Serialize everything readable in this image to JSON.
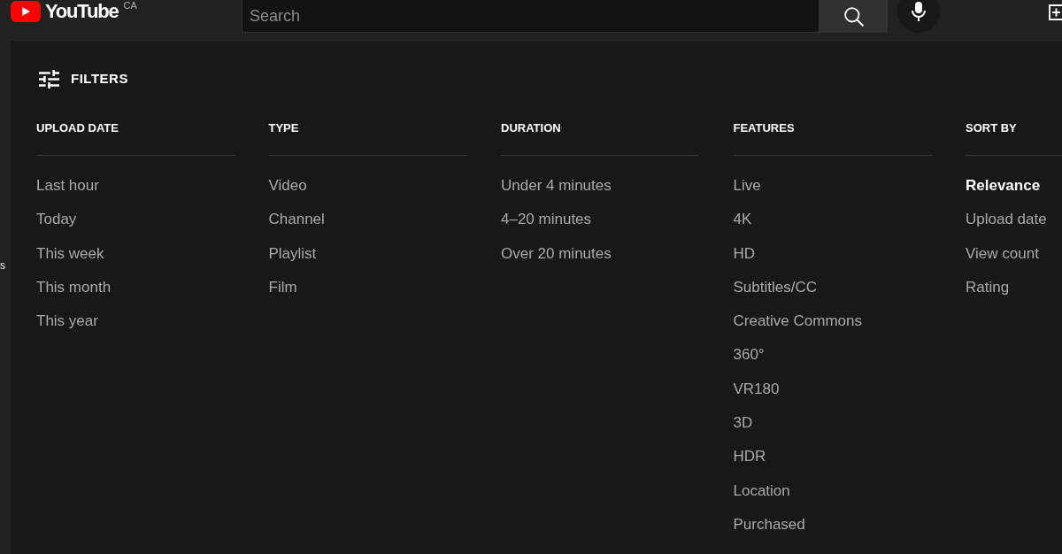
{
  "header": {
    "logo": {
      "text": "YouTube",
      "country": "CA"
    },
    "search": {
      "placeholder": "Search"
    }
  },
  "sidebar": {
    "items": [
      {
        "label": "s"
      }
    ]
  },
  "filters": {
    "title": "FILTERS",
    "groups": [
      {
        "heading": "UPLOAD DATE",
        "options": [
          {
            "label": "Last hour",
            "selected": false
          },
          {
            "label": "Today",
            "selected": false
          },
          {
            "label": "This week",
            "selected": false
          },
          {
            "label": "This month",
            "selected": false
          },
          {
            "label": "This year",
            "selected": false
          }
        ]
      },
      {
        "heading": "TYPE",
        "options": [
          {
            "label": "Video",
            "selected": false
          },
          {
            "label": "Channel",
            "selected": false
          },
          {
            "label": "Playlist",
            "selected": false
          },
          {
            "label": "Film",
            "selected": false
          }
        ]
      },
      {
        "heading": "DURATION",
        "options": [
          {
            "label": "Under 4 minutes",
            "selected": false
          },
          {
            "label": "4–20 minutes",
            "selected": false
          },
          {
            "label": "Over 20 minutes",
            "selected": false
          }
        ]
      },
      {
        "heading": "FEATURES",
        "options": [
          {
            "label": "Live",
            "selected": false
          },
          {
            "label": "4K",
            "selected": false
          },
          {
            "label": "HD",
            "selected": false
          },
          {
            "label": "Subtitles/CC",
            "selected": false
          },
          {
            "label": "Creative Commons",
            "selected": false
          },
          {
            "label": "360°",
            "selected": false
          },
          {
            "label": "VR180",
            "selected": false
          },
          {
            "label": "3D",
            "selected": false
          },
          {
            "label": "HDR",
            "selected": false
          },
          {
            "label": "Location",
            "selected": false
          },
          {
            "label": "Purchased",
            "selected": false
          }
        ]
      },
      {
        "heading": "SORT BY",
        "options": [
          {
            "label": "Relevance",
            "selected": true
          },
          {
            "label": "Upload date",
            "selected": false
          },
          {
            "label": "View count",
            "selected": false
          },
          {
            "label": "Rating",
            "selected": false
          }
        ]
      }
    ]
  }
}
